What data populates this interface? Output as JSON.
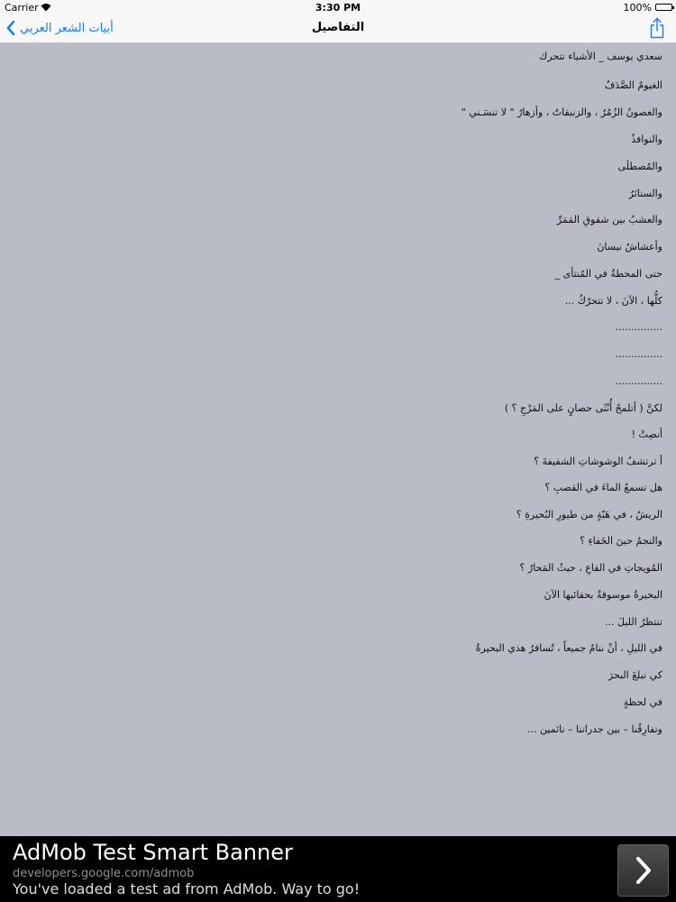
{
  "status_bar": {
    "carrier": "Carrier",
    "time": "3:30 PM",
    "battery": "100%"
  },
  "nav": {
    "back_label": "أبيات الشعر العربي",
    "title": "التفاصيل"
  },
  "poem": {
    "lines": [
      "سعدي يوسف _ الأشياء تتحرك",
      "الغيومُ الصَّدَفُ",
      "والغصونُ الزُمُرُ ، والزنبقاتُ ، وأزهارُ \" لا تنسَـني \"",
      "والنوافذُ",
      "والمُصطلَى",
      "والستائرُ",
      "والعشبُ بين شقوقِ المَمَرِّ",
      "وأعشاشُ نيسانَ",
      "حتى المحطةُ في المُنتأى _",
      "كلُّها ، الآنَ ، لا تتحرّكُ ...",
      "...............",
      "...............",
      "...............",
      "لكنَّ ( أتلمحُ أُنْثَى حصانٍ على المَرْجِ ؟ )",
      "أنصِتْ !",
      "أ ترتشفُ الوشوشاتِ الشفيفةَ ؟",
      "هل تسمعُ الماءَ في القصبِ ؟",
      "الريشُ ، في هَبّةٍ من طيورِ البُحيرةِ ؟",
      "والنجمُ حينَ الخَفاءِ ؟",
      "المُويجاتِ في القاعِ ، حيثُ المَحارُ ؟",
      "البحيرةُ موسوقةٌ بحقائبها الآنَ",
      "تنتظرُ الليلَ ...",
      "في الليلِ ، أنْ ننامُ جميعاً ، تُسافرُ هذي البحيرةُ",
      "كي تبلغَ البحرَ",
      "في لحظةٍ",
      "وتفارِقُنا – بين جدراننا – نائمين ..."
    ]
  },
  "ad": {
    "title": "AdMob Test Smart Banner",
    "url": "developers.google.com/admob",
    "description": "You've loaded a test ad from AdMob. Way to go!"
  }
}
